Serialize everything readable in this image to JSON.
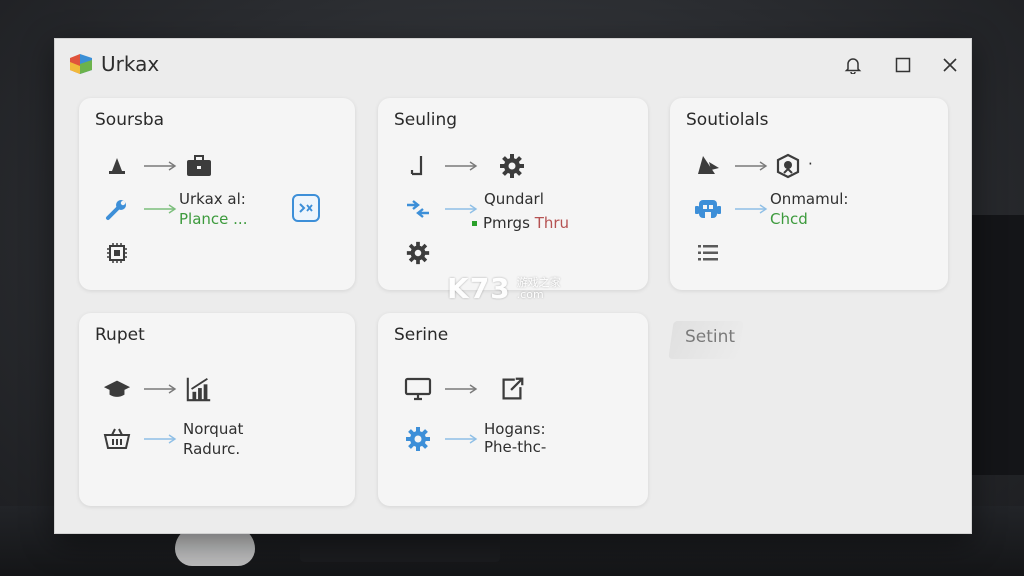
{
  "app": {
    "title": "Urkax",
    "logo_colors": [
      "#e0533c",
      "#3b8fd6",
      "#6cb34c",
      "#f0b93a"
    ]
  },
  "window_controls": [
    "bell-icon",
    "maximize-icon",
    "close-icon"
  ],
  "cards": {
    "soursba": {
      "title": "Soursba",
      "line1": "Urkax al:",
      "line2": "Plance ..."
    },
    "seuling": {
      "title": "Seuling",
      "line1": "Qundarl",
      "line2a": "Pmrgs",
      "line2b": "Thru"
    },
    "soutiolals": {
      "title": "Soutiolals",
      "line1": "Onmamul:",
      "line2": "Chcd",
      "badge": "·"
    },
    "rupet": {
      "title": "Rupet",
      "line1": "Norquat",
      "line2": "Radurc."
    },
    "serine": {
      "title": "Serine",
      "line1": "Hogans:",
      "line2": "Phe-thc-"
    },
    "setint": {
      "title": "Setint"
    }
  },
  "watermark": {
    "brand": "K73",
    "sub1": "游戏之家",
    "sub2": ".com"
  },
  "colors": {
    "accent_blue": "#3d8fd8",
    "accent_green": "#3c9a3c",
    "accent_red": "#b55252",
    "icon_dark": "#3c3c3c"
  }
}
